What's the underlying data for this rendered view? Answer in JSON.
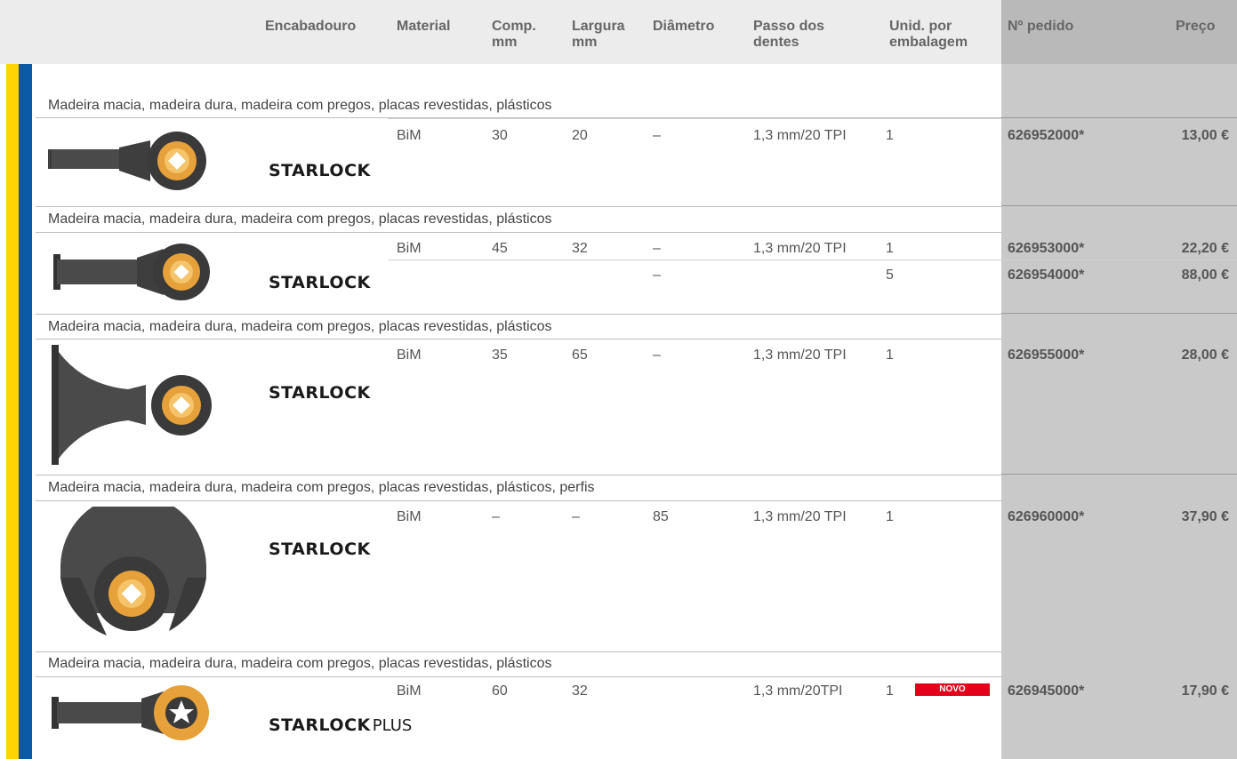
{
  "header": {
    "encabadouro": "Encabadouro",
    "material": "Material",
    "comp_1": "Comp.",
    "comp_2": "mm",
    "largura_1": "Largura",
    "largura_2": "mm",
    "diametro": "Diâmetro",
    "passo_1": "Passo dos",
    "passo_2": "dentes",
    "unid_1": "Unid. por",
    "unid_2": "embalagem",
    "pedido": "Nº pedido",
    "preco": "Preço"
  },
  "logo": {
    "main": "STARLOCK",
    "plus": "PLUS"
  },
  "badge": {
    "novo": "NOVO"
  },
  "colors": {
    "yellow": "#ffd400",
    "blue": "#0a5aa8",
    "novo_red": "#e3001b",
    "order_bg": "#c9c9c9"
  },
  "sections": [
    {
      "title": "Madeira macia, madeira dura, madeira com pregos, placas revestidas, plásticos",
      "logo": "STARLOCK",
      "rows": [
        {
          "material": "BiM",
          "comp": "30",
          "largura": "20",
          "diametro": "–",
          "passo": "1,3 mm/20 TPI",
          "unid": "1",
          "pedido": "626952000*",
          "preco": "13,00 €"
        }
      ]
    },
    {
      "title": "Madeira macia, madeira dura, madeira com pregos, placas revestidas, plásticos",
      "logo": "STARLOCK",
      "rows": [
        {
          "material": "BiM",
          "comp": "45",
          "largura": "32",
          "diametro": "–",
          "passo": "1,3 mm/20 TPI",
          "unid": "1",
          "pedido": "626953000*",
          "preco": "22,20 €"
        },
        {
          "material": "",
          "comp": "",
          "largura": "",
          "diametro": "–",
          "passo": "",
          "unid": "5",
          "pedido": "626954000*",
          "preco": "88,00 €"
        }
      ]
    },
    {
      "title": "Madeira macia, madeira dura, madeira com pregos, placas revestidas, plásticos",
      "logo": "STARLOCK",
      "rows": [
        {
          "material": "BiM",
          "comp": "35",
          "largura": "65",
          "diametro": "–",
          "passo": "1,3 mm/20 TPI",
          "unid": "1",
          "pedido": "626955000*",
          "preco": "28,00 €"
        }
      ]
    },
    {
      "title": "Madeira macia, madeira dura, madeira com pregos, placas revestidas, plásticos, perfis",
      "logo": "STARLOCK",
      "rows": [
        {
          "material": "BiM",
          "comp": "–",
          "largura": "–",
          "diametro": "85",
          "passo": "1,3 mm/20 TPI",
          "unid": "1",
          "pedido": "626960000*",
          "preco": "37,90 €"
        }
      ]
    },
    {
      "title": "Madeira macia, madeira dura, madeira com pregos, placas revestidas, plásticos",
      "logo": "STARLOCK PLUS",
      "rows": [
        {
          "material": "BiM",
          "comp": "60",
          "largura": "32",
          "diametro": "",
          "passo": "1,3 mm/20TPI",
          "unid": "1",
          "pedido": "626945000*",
          "preco": "17,90 €"
        }
      ]
    }
  ]
}
